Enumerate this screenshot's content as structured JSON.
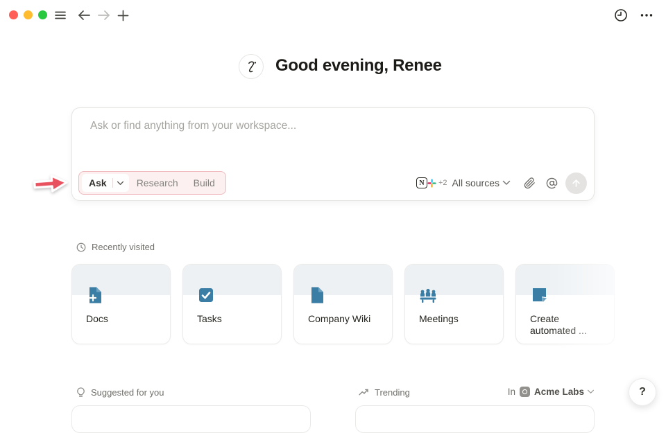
{
  "accents": {
    "annotation_red": "#e8515e",
    "highlight_ring_pink": "#f0b9bd",
    "card_band_blue": "#edf1f4",
    "card_icon_blue": "#3a7da5",
    "traffic_red": "#ff5f57",
    "traffic_yellow": "#febc2e",
    "traffic_green": "#28c840"
  },
  "greeting": {
    "title": "Good evening, Renee"
  },
  "composer": {
    "placeholder": "Ask or find anything from your workspace...",
    "active_mode": "Ask",
    "modes": [
      {
        "label": "Ask"
      },
      {
        "label": "Research"
      },
      {
        "label": "Build"
      }
    ],
    "sources": {
      "icons": [
        "notion-icon",
        "slack-icon"
      ],
      "extra_count": "+2",
      "label": "All sources"
    }
  },
  "recently_visited": {
    "label": "Recently visited",
    "cards": [
      {
        "title": "Docs",
        "icon": "doc-plus-icon"
      },
      {
        "title": "Tasks",
        "icon": "task-check-icon"
      },
      {
        "title": "Company Wiki",
        "icon": "wiki-doc-icon"
      },
      {
        "title": "Meetings",
        "icon": "meeting-people-icon"
      },
      {
        "title": "Create automated ...",
        "icon": "template-icon"
      }
    ]
  },
  "footer": {
    "suggested_label": "Suggested for you",
    "trending_label": "Trending",
    "scope_prefix": "In",
    "workspace_name": "Acme Labs",
    "help_label": "?"
  }
}
